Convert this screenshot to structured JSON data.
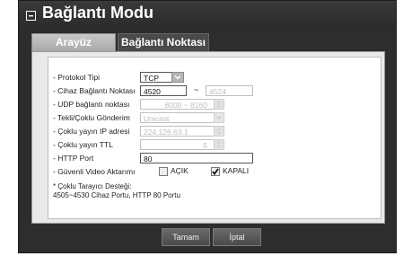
{
  "window": {
    "title": "Bağlantı Modu"
  },
  "tabs": [
    {
      "label": "Arayüz",
      "active": false
    },
    {
      "label": "Bağlantı Noktası",
      "active": true
    }
  ],
  "form": {
    "protocol_label": "- Protokol Tipi",
    "protocol_value": "TCP",
    "device_port_label": "- Cihaz Bağlantı Noktası",
    "device_port_from": "4520",
    "device_port_sep": "~",
    "device_port_to": "4524",
    "udp_label": "- UDP bağlantı noktası",
    "udp_value": "8000 ~ 8160",
    "unicast_label": "- Tekli/Çoklu Gönderim",
    "unicast_value": "Unicast",
    "multicast_ip_label": "- Çoklu yayın IP adresi",
    "multicast_ip_value": "224.126.63.1",
    "multicast_ttl_label": "- Çoklu yayın TTL",
    "multicast_ttl_value": "5",
    "http_label": "- HTTP Port",
    "http_value": "80",
    "secure_label": "- Güvenli Video Aktarımı",
    "secure_on_label": "AÇIK",
    "secure_off_label": "KAPALI",
    "secure_on_checked": false,
    "secure_off_checked": true,
    "note_line1": "* Çoklu Tarayıcı Desteği:",
    "note_line2": "4505~4530 Cihaz Portu, HTTP 80 Portu"
  },
  "buttons": {
    "ok": "Tamam",
    "cancel": "İptal"
  }
}
